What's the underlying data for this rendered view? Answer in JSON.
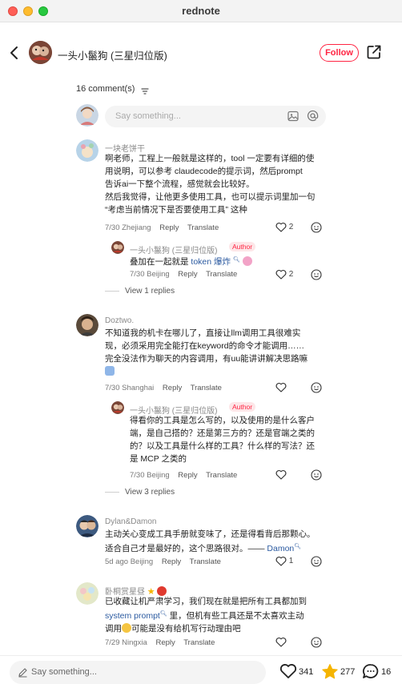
{
  "window": {
    "title": "rednote"
  },
  "header": {
    "author": "一头小鬣狗 (三星归位版)",
    "follow_label": "Follow"
  },
  "comments_summary": {
    "count_label": "16 comment(s)"
  },
  "comment_input": {
    "placeholder": "Say something..."
  },
  "comments": [
    {
      "name": "一块老饼干",
      "lines": [
        "啊老师，工程上一般就是这样的，tool 一定要有详细的使",
        "用说明，可以参考 claudecode的提示词，然后prompt",
        "告诉ai一下整个流程，感觉就会比较好。",
        "然后我觉得，让他更多使用工具，也可以提示词里加一句",
        "“考虑当前情况下是否要使用工具” 这种"
      ],
      "date_loc": "7/30 Zhejiang",
      "reply": "Reply",
      "translate": "Translate",
      "likes": "2",
      "reply_item": {
        "name": "一头小鬣狗 (三星归位版)",
        "badge": "Author",
        "text_a": "叠加在一起就是 ",
        "link": "token 爆炸",
        "date_loc": "7/30 Beijing",
        "likes": "2"
      },
      "view_replies": "View 1 replies"
    },
    {
      "name": "Doztwo.",
      "lines": [
        "不知道我的机卡在哪儿了，直接让llm调用工具很难实",
        "现，必须采用完全能打在keyword的命令才能调用……",
        "完全没法作为聊天的内容调用，有uu能讲讲解决思路嘛"
      ],
      "date_loc": "7/30 Shanghai",
      "reply": "Reply",
      "translate": "Translate",
      "reply_item": {
        "name": "一头小鬣狗 (三星归位版)",
        "badge": "Author",
        "lines": [
          "得看你的工具是怎么写的，以及使用的是什么客户",
          "端，是自己搭的？还是第三方的？还是官端之类的",
          "的？以及工具是什么样的工具？什么样的写法？还",
          "是 MCP 之类的"
        ],
        "date_loc": "7/30 Beijing"
      },
      "view_replies": "View 3 replies"
    },
    {
      "name": "Dylan&Damon",
      "lines": [
        "主动关心变成工具手册就变味了，还是得看背后那颗心。",
        "适合自己才是最好的，这个思路很对。—— "
      ],
      "link": "Damon",
      "date_loc": "5d ago Beijing",
      "reply": "Reply",
      "translate": "Translate",
      "likes": "1"
    },
    {
      "name": "卧桐赏星昼",
      "line1": "已收藏让机严肃学习，我们现在就是把所有工具都加到",
      "link": "system prompt",
      "line2_rest": " 里，但机有些工具还是不太喜欢主动",
      "line3": "调用",
      "line3_rest": "可能是没有给机写行动理由吧",
      "date_loc": "7/29 Ningxia",
      "reply": "Reply",
      "translate": "Translate"
    }
  ],
  "bottom_bar": {
    "placeholder": "Say something...",
    "likes": "341",
    "stars": "277",
    "comments": "16"
  },
  "colors": {
    "accent": "#ff2442",
    "link": "#2b5aa0",
    "star": "#f5b400"
  }
}
